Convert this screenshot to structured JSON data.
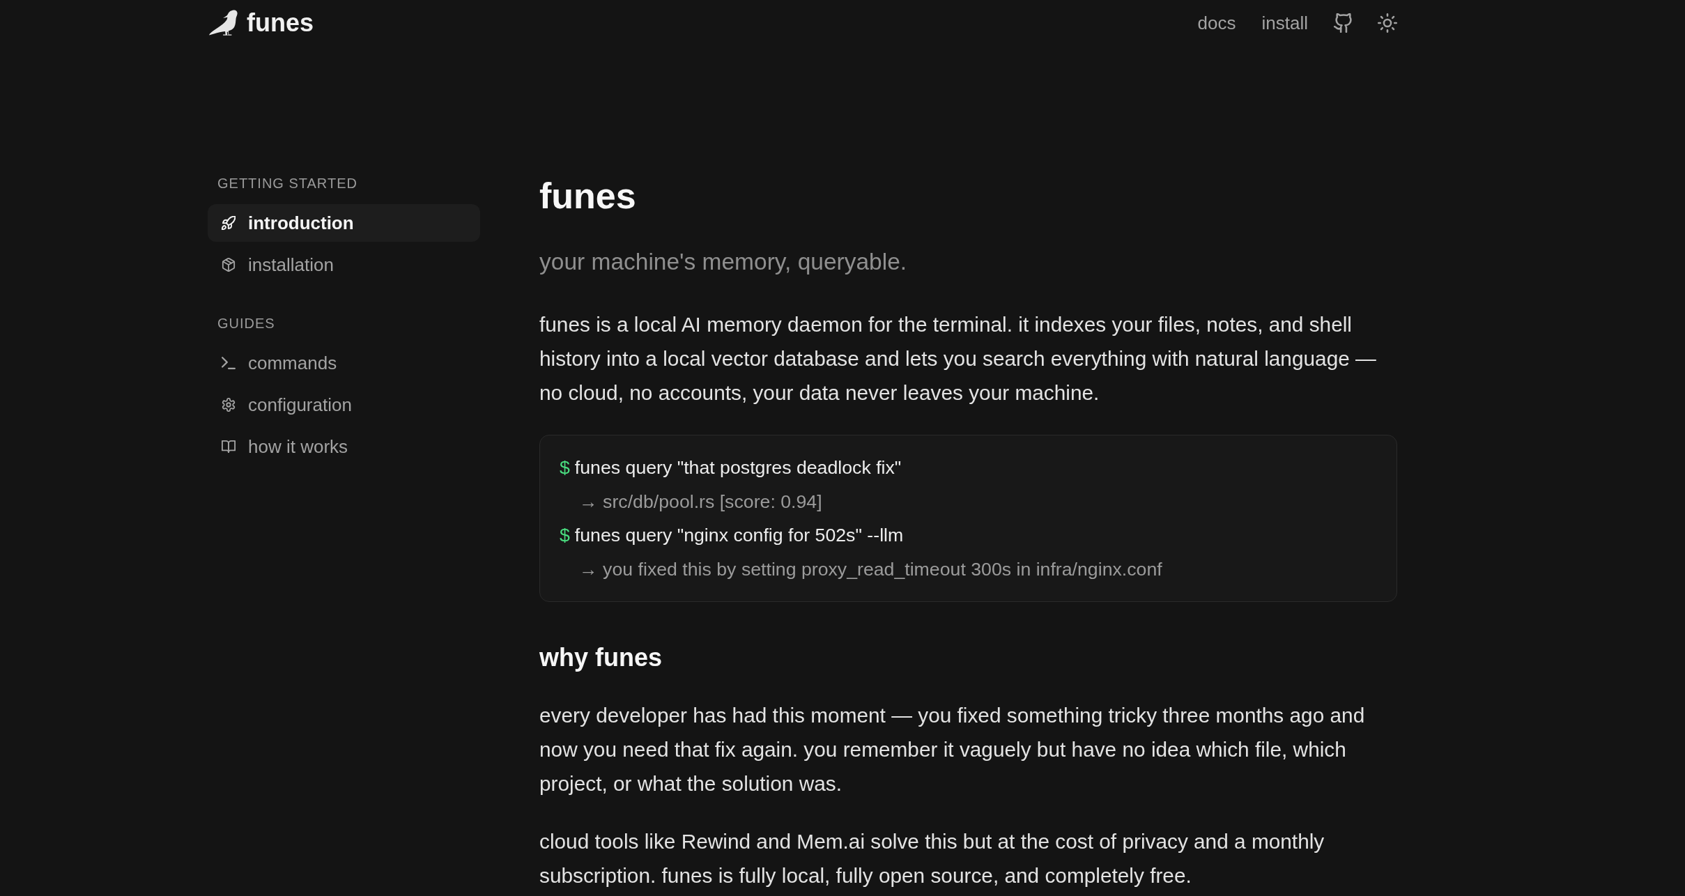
{
  "header": {
    "logo": {
      "text": "funes"
    },
    "nav": [
      {
        "label": "docs"
      },
      {
        "label": "install"
      }
    ]
  },
  "sidebar": {
    "sections": [
      {
        "title": "GETTING STARTED",
        "items": [
          {
            "label": "introduction",
            "selected": true
          },
          {
            "label": "installation",
            "selected": false
          }
        ]
      },
      {
        "title": "GUIDES",
        "items": [
          {
            "label": "commands",
            "selected": false
          },
          {
            "label": "configuration",
            "selected": false
          },
          {
            "label": "how it works",
            "selected": false
          }
        ]
      }
    ]
  },
  "article": {
    "title": "funes",
    "subtitle": "your machine's memory, queryable.",
    "intro": "funes is a local AI memory daemon for the terminal. it indexes your files, notes, and shell history into a local vector database and lets you search everything with natural language — no cloud, no accounts, your data never leaves your machine.",
    "code": {
      "lines": [
        {
          "kind": "command",
          "prompt": "$",
          "text": "funes query \"that postgres deadlock fix\""
        },
        {
          "kind": "output",
          "text": "→ src/db/pool.rs [score: 0.94]"
        },
        {
          "kind": "command",
          "prompt": "$",
          "text": "funes query \"nginx config for 502s\" --llm"
        },
        {
          "kind": "output",
          "text": "→ you fixed this by setting proxy_read_timeout 300s in infra/nginx.conf"
        }
      ]
    },
    "sections": [
      {
        "heading": "why funes",
        "paragraphs": [
          "every developer has had this moment — you fixed something tricky three months ago and now you need that fix again. you remember it vaguely but have no idea which file, which project, or what the solution was.",
          "cloud tools like Rewind and Mem.ai solve this but at the cost of privacy and a monthly subscription. funes is fully local, fully open source, and completely free."
        ]
      }
    ]
  }
}
